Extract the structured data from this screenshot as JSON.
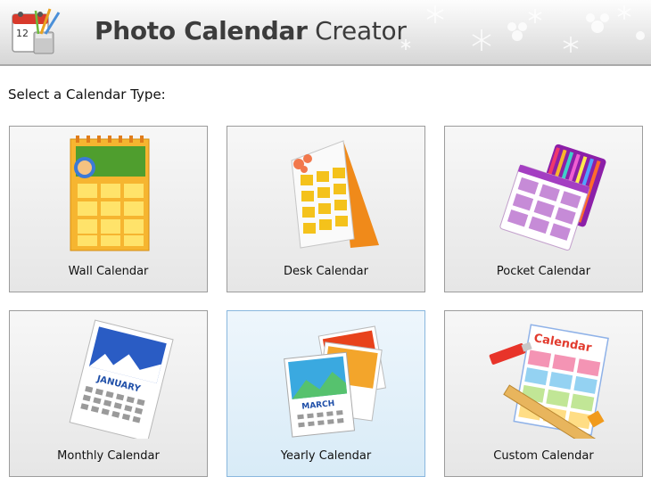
{
  "app": {
    "title_bold": "Photo Calendar",
    "title_rest": " Creator",
    "logo_day": "12"
  },
  "prompt": "Select a Calendar Type:",
  "tiles": [
    {
      "label": "Wall Calendar",
      "icon": "wall-calendar-icon"
    },
    {
      "label": "Desk Calendar",
      "icon": "desk-calendar-icon"
    },
    {
      "label": "Pocket Calendar",
      "icon": "pocket-calendar-icon"
    },
    {
      "label": "Monthly Calendar",
      "icon": "monthly-calendar-icon",
      "month": "JANUARY"
    },
    {
      "label": "Yearly Calendar",
      "icon": "yearly-calendar-icon",
      "month": "MARCH",
      "selected": true
    },
    {
      "label": "Custom Calendar",
      "icon": "custom-calendar-icon",
      "banner": "Calendar"
    }
  ],
  "colors": {
    "selected_border": "#89b7de",
    "selected_bg": "#d8ebf7",
    "tile_border": "#9c9c9c"
  }
}
